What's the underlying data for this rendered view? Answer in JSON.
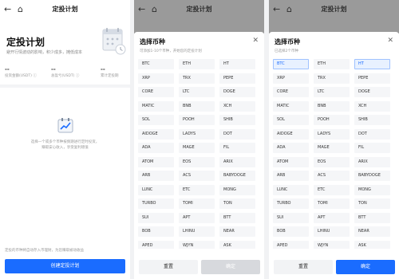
{
  "nav": {
    "back_icon": "back-arrow-icon",
    "home_icon": "home-icon",
    "title": "定投计划"
  },
  "home": {
    "hero_title": "定投计划",
    "hero_subtitle": "避开行情波动的影响，积少成多，摊低成本",
    "stats": [
      {
        "value": "--",
        "label": "投资金额(USDT)"
      },
      {
        "value": "--",
        "label": "总盈亏(USDT)"
      },
      {
        "value": "--",
        "label": "累计定投期"
      }
    ],
    "empty_text_line1": "选择一个或多个币种按频期进行定时投资，",
    "empty_text_line2": "赚取安心收入，享受复利增值",
    "footer_note": "定投的币种将自动存入币理财，为您赚取被动收益",
    "create_button": "创建定投计划"
  },
  "picker_a": {
    "title": "选择币种",
    "hint": "可添加1-10个币种，开始您的定投计划",
    "reset": "重置",
    "confirm": "确定"
  },
  "picker_b": {
    "title": "选择币种",
    "hint": "已选择2个币种",
    "reset": "重置",
    "confirm": "确定"
  },
  "coins": [
    "BTC",
    "ETH",
    "HT",
    "XRP",
    "TRX",
    "PEPE",
    "CORE",
    "LTC",
    "DOGE",
    "MATIC",
    "BNB",
    "XCH",
    "SOL",
    "POOH",
    "SHIB",
    "AIDOGE",
    "LADYS",
    "DOT",
    "ADA",
    "MAGE",
    "FIL",
    "ATOM",
    "EOS",
    "ARIX",
    "ARB",
    "ACS",
    "BABYDOGE",
    "LUNC",
    "ETC",
    "MONG",
    "TURBO",
    "TOMI",
    "TON",
    "SUI",
    "APT",
    "BTT",
    "BOB",
    "LHINU",
    "NEAR",
    "APED",
    "WJYN",
    "ASK"
  ],
  "selected_coins": [
    "BTC",
    "HT"
  ],
  "colors": {
    "accent": "#1a6cff",
    "disabled": "#d7d9dd",
    "dim": "#9a9a9a"
  }
}
